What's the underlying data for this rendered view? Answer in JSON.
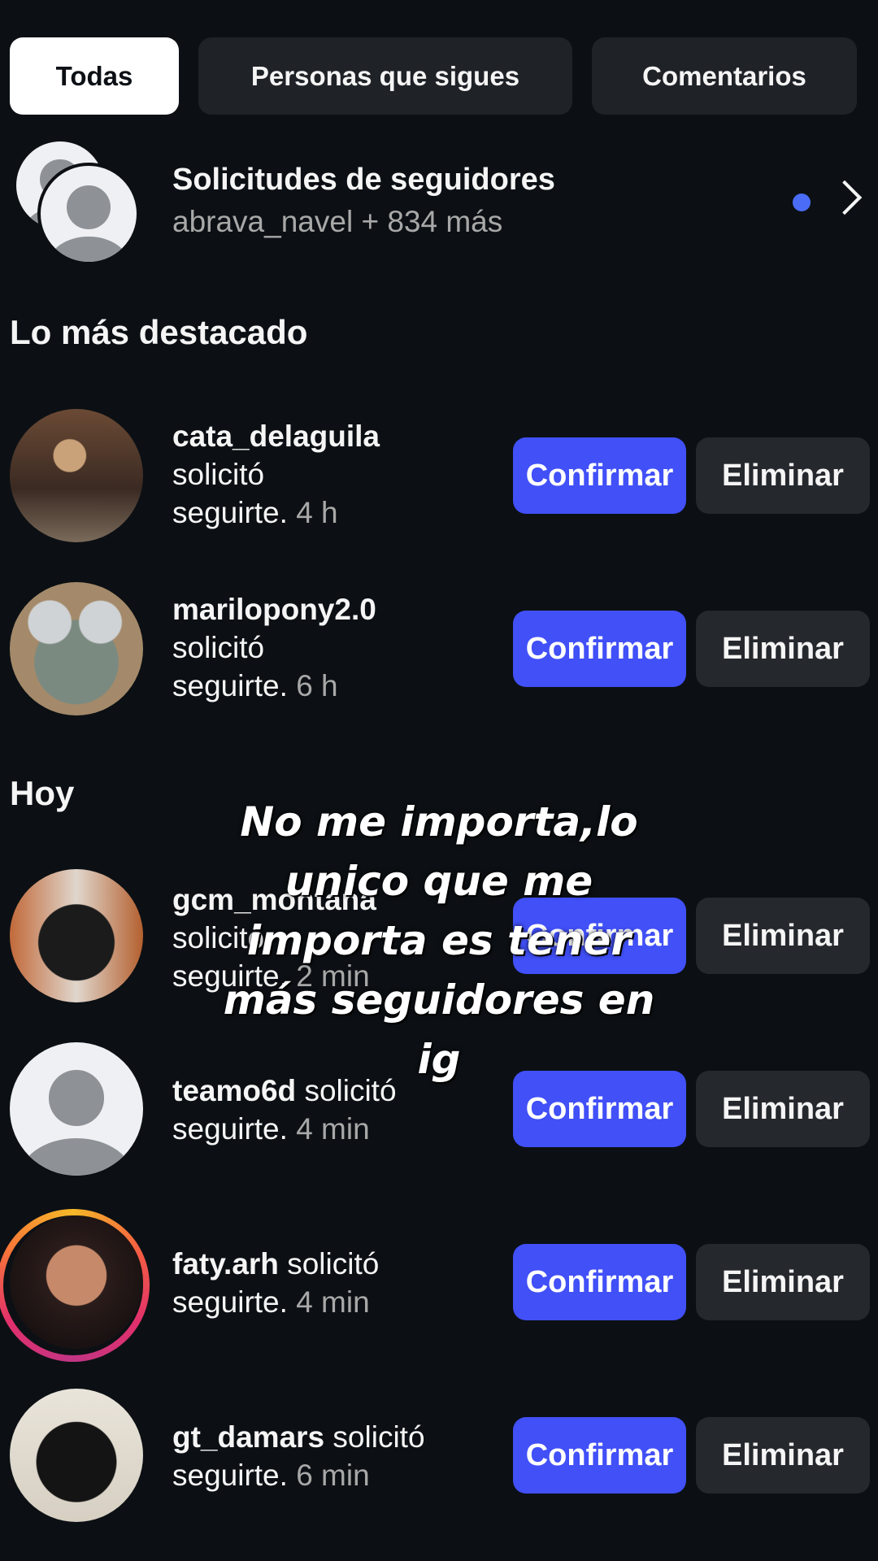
{
  "tabs": [
    {
      "label": "Todas",
      "active": true
    },
    {
      "label": "Personas que sigues",
      "active": false
    },
    {
      "label": "Comentarios",
      "active": false
    }
  ],
  "follow_requests": {
    "title": "Solicitudes de seguidores",
    "subtitle": "abrava_navel + 834 más"
  },
  "sections": {
    "highlights": "Lo más destacado",
    "today": "Hoy"
  },
  "buttons": {
    "confirm": "Confirmar",
    "delete": "Eliminar"
  },
  "items": [
    {
      "username": "cata_delaguila",
      "action_line1": "solicitó",
      "action_line2": "seguirte.",
      "time": "4 h"
    },
    {
      "username": "marilopony2.0",
      "action_line1": "solicitó",
      "action_line2": "seguirte.",
      "time": "6 h"
    },
    {
      "username": "gcm_montana",
      "action_line1": "solicitó",
      "action_line2": "seguirte.",
      "time": "2 min"
    },
    {
      "username": "teamo6d",
      "action_line1": "solicitó",
      "action_line2": "seguirte.",
      "time": "4 min"
    },
    {
      "username": "faty.arh",
      "action_line1": "solicitó",
      "action_line2": "seguirte.",
      "time": "4 min"
    },
    {
      "username": "gt_damars",
      "action_line1": "solicitó",
      "action_line2": "seguirte.",
      "time": "6 min"
    }
  ],
  "overlay_caption": "No me importa,lo\nunico que me\nimporta es tener\nmás seguidores en\nig",
  "colors": {
    "background": "#0c1014",
    "confirm_button": "#4150f7",
    "delete_button": "#25282d",
    "unread_dot": "#4a6cf7"
  }
}
